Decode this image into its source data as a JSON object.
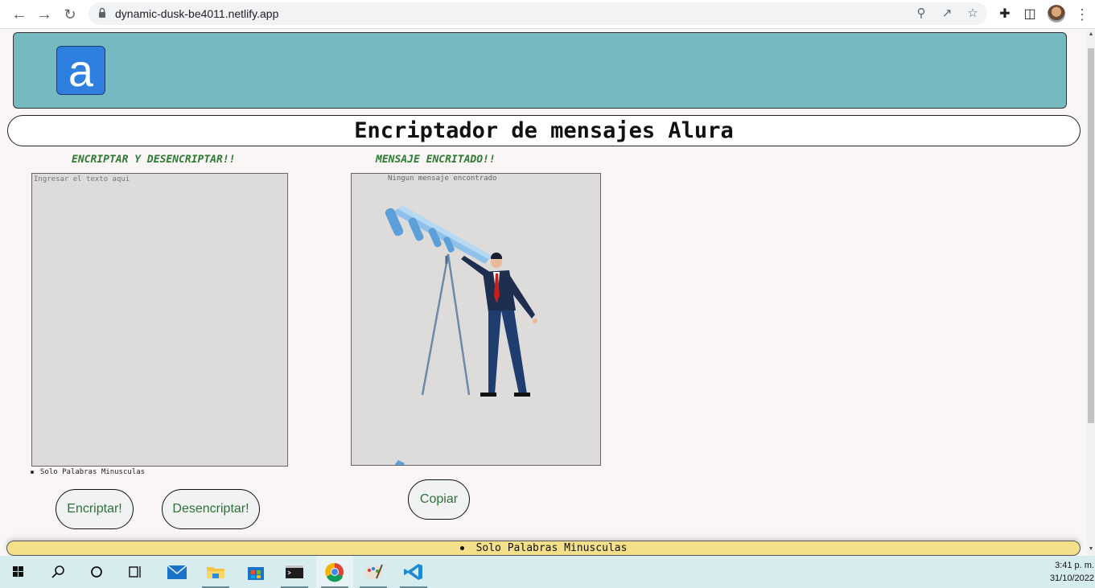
{
  "browser": {
    "url": "dynamic-dusk-be4011.netlify.app",
    "back_icon": "back-arrow-icon",
    "forward_icon": "forward-arrow-icon",
    "reload_icon": "reload-icon"
  },
  "page": {
    "logo_letter": "a",
    "title": "Encriptador de mensajes Alura",
    "left_label": "ENCRIPTAR Y DESENCRIPTAR!!",
    "right_label": "MENSAJE ENCRITADO!!",
    "input_placeholder": "Ingresar el texto aqui",
    "hint": "Solo Palabras Minusculas",
    "encrypt_button": "Encriptar!",
    "decrypt_button": "Desencriptar!",
    "output_empty_text": "Ningun mensaje encontrado",
    "copy_button": "Copiar",
    "footer_text": "Solo Palabras Minusculas"
  },
  "colors": {
    "header_bg": "#77b9c1",
    "label_green": "#2f7a35",
    "footer_bg": "#f4e08a",
    "logo_blue": "#2f7fe0"
  },
  "taskbar": {
    "time": "3:41 p. m.",
    "date": "31/10/2022"
  }
}
